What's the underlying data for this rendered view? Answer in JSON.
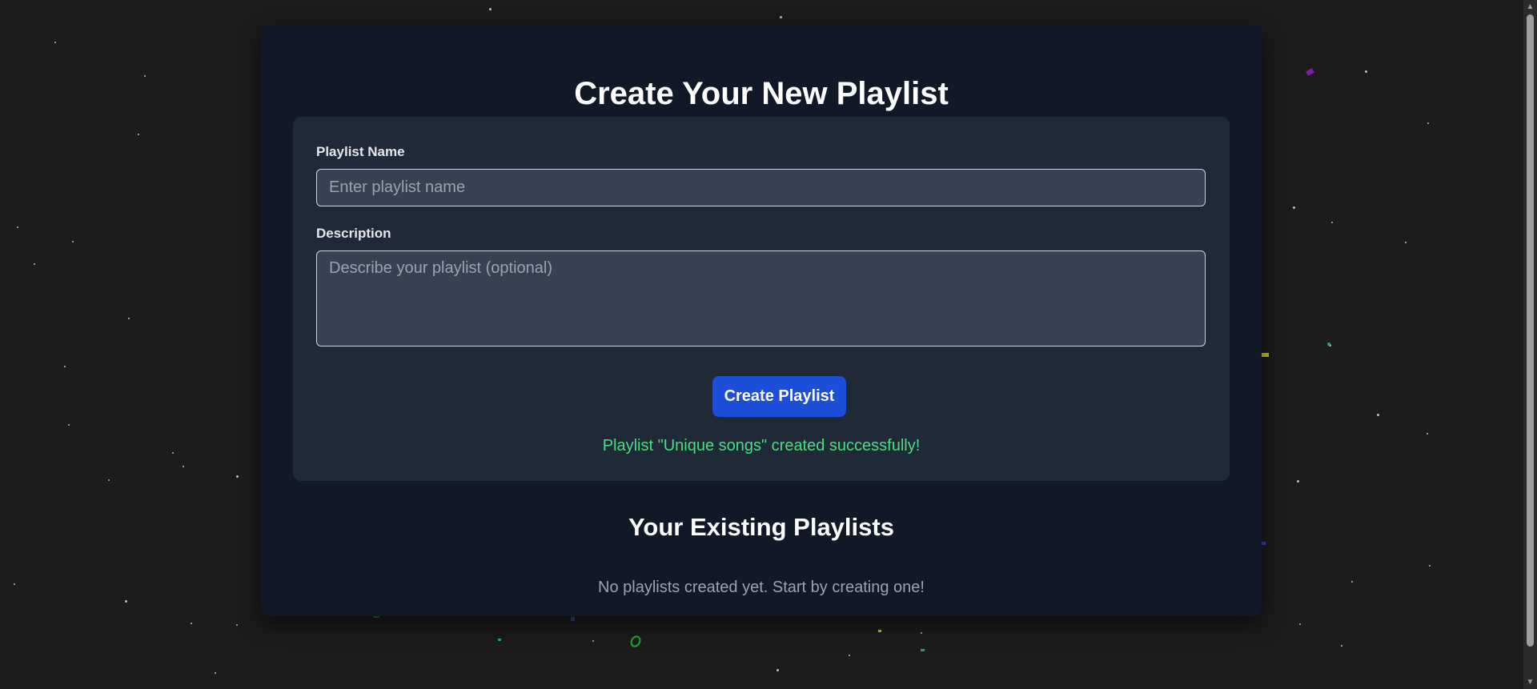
{
  "form": {
    "title": "Create Your New Playlist",
    "name_label": "Playlist Name",
    "name_placeholder": "Enter playlist name",
    "name_value": "",
    "description_label": "Description",
    "description_placeholder": "Describe your playlist (optional)",
    "description_value": "",
    "submit_label": "Create Playlist",
    "success_message": "Playlist \"Unique songs\" created successfully!"
  },
  "playlists": {
    "title": "Your Existing Playlists",
    "empty_message": "No playlists created yet. Start by creating one!",
    "items": []
  },
  "scrollbar": {
    "up_icon": "scroll-up-arrow-icon",
    "down_icon": "scroll-down-arrow-icon"
  },
  "colors": {
    "page_background": "#1c1c1c",
    "card_background": "#111827",
    "panel_background": "#1f2937",
    "input_background": "#374151",
    "accent": "#1d4ed8",
    "success": "#4ade80"
  }
}
